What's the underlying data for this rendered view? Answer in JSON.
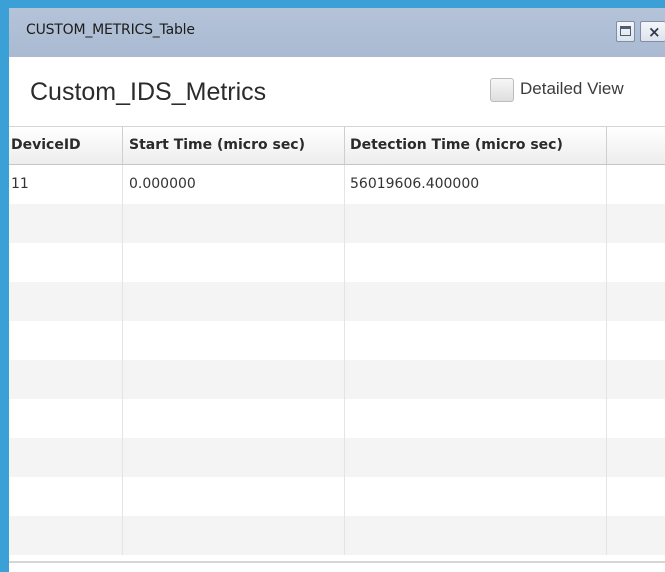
{
  "window": {
    "title": "CUSTOM_METRICS_Table",
    "restore_icon": "restore-window-icon",
    "close_label": "×",
    "accent_color": "#3aa0d6",
    "titlebar_color": "#b0c0d6"
  },
  "panel": {
    "heading": "Custom_IDS_Metrics",
    "detailed_view": {
      "label": "Detailed View",
      "checked": false
    }
  },
  "table": {
    "columns": [
      "DeviceID",
      "Start Time (micro sec)",
      "Detection Time (micro sec)",
      ""
    ],
    "rows": [
      [
        "11",
        "0.000000",
        "56019606.400000",
        ""
      ],
      [
        "",
        "",
        "",
        ""
      ],
      [
        "",
        "",
        "",
        ""
      ],
      [
        "",
        "",
        "",
        ""
      ],
      [
        "",
        "",
        "",
        ""
      ],
      [
        "",
        "",
        "",
        ""
      ],
      [
        "",
        "",
        "",
        ""
      ],
      [
        "",
        "",
        "",
        ""
      ],
      [
        "",
        "",
        "",
        ""
      ],
      [
        "",
        "",
        "",
        ""
      ]
    ]
  }
}
